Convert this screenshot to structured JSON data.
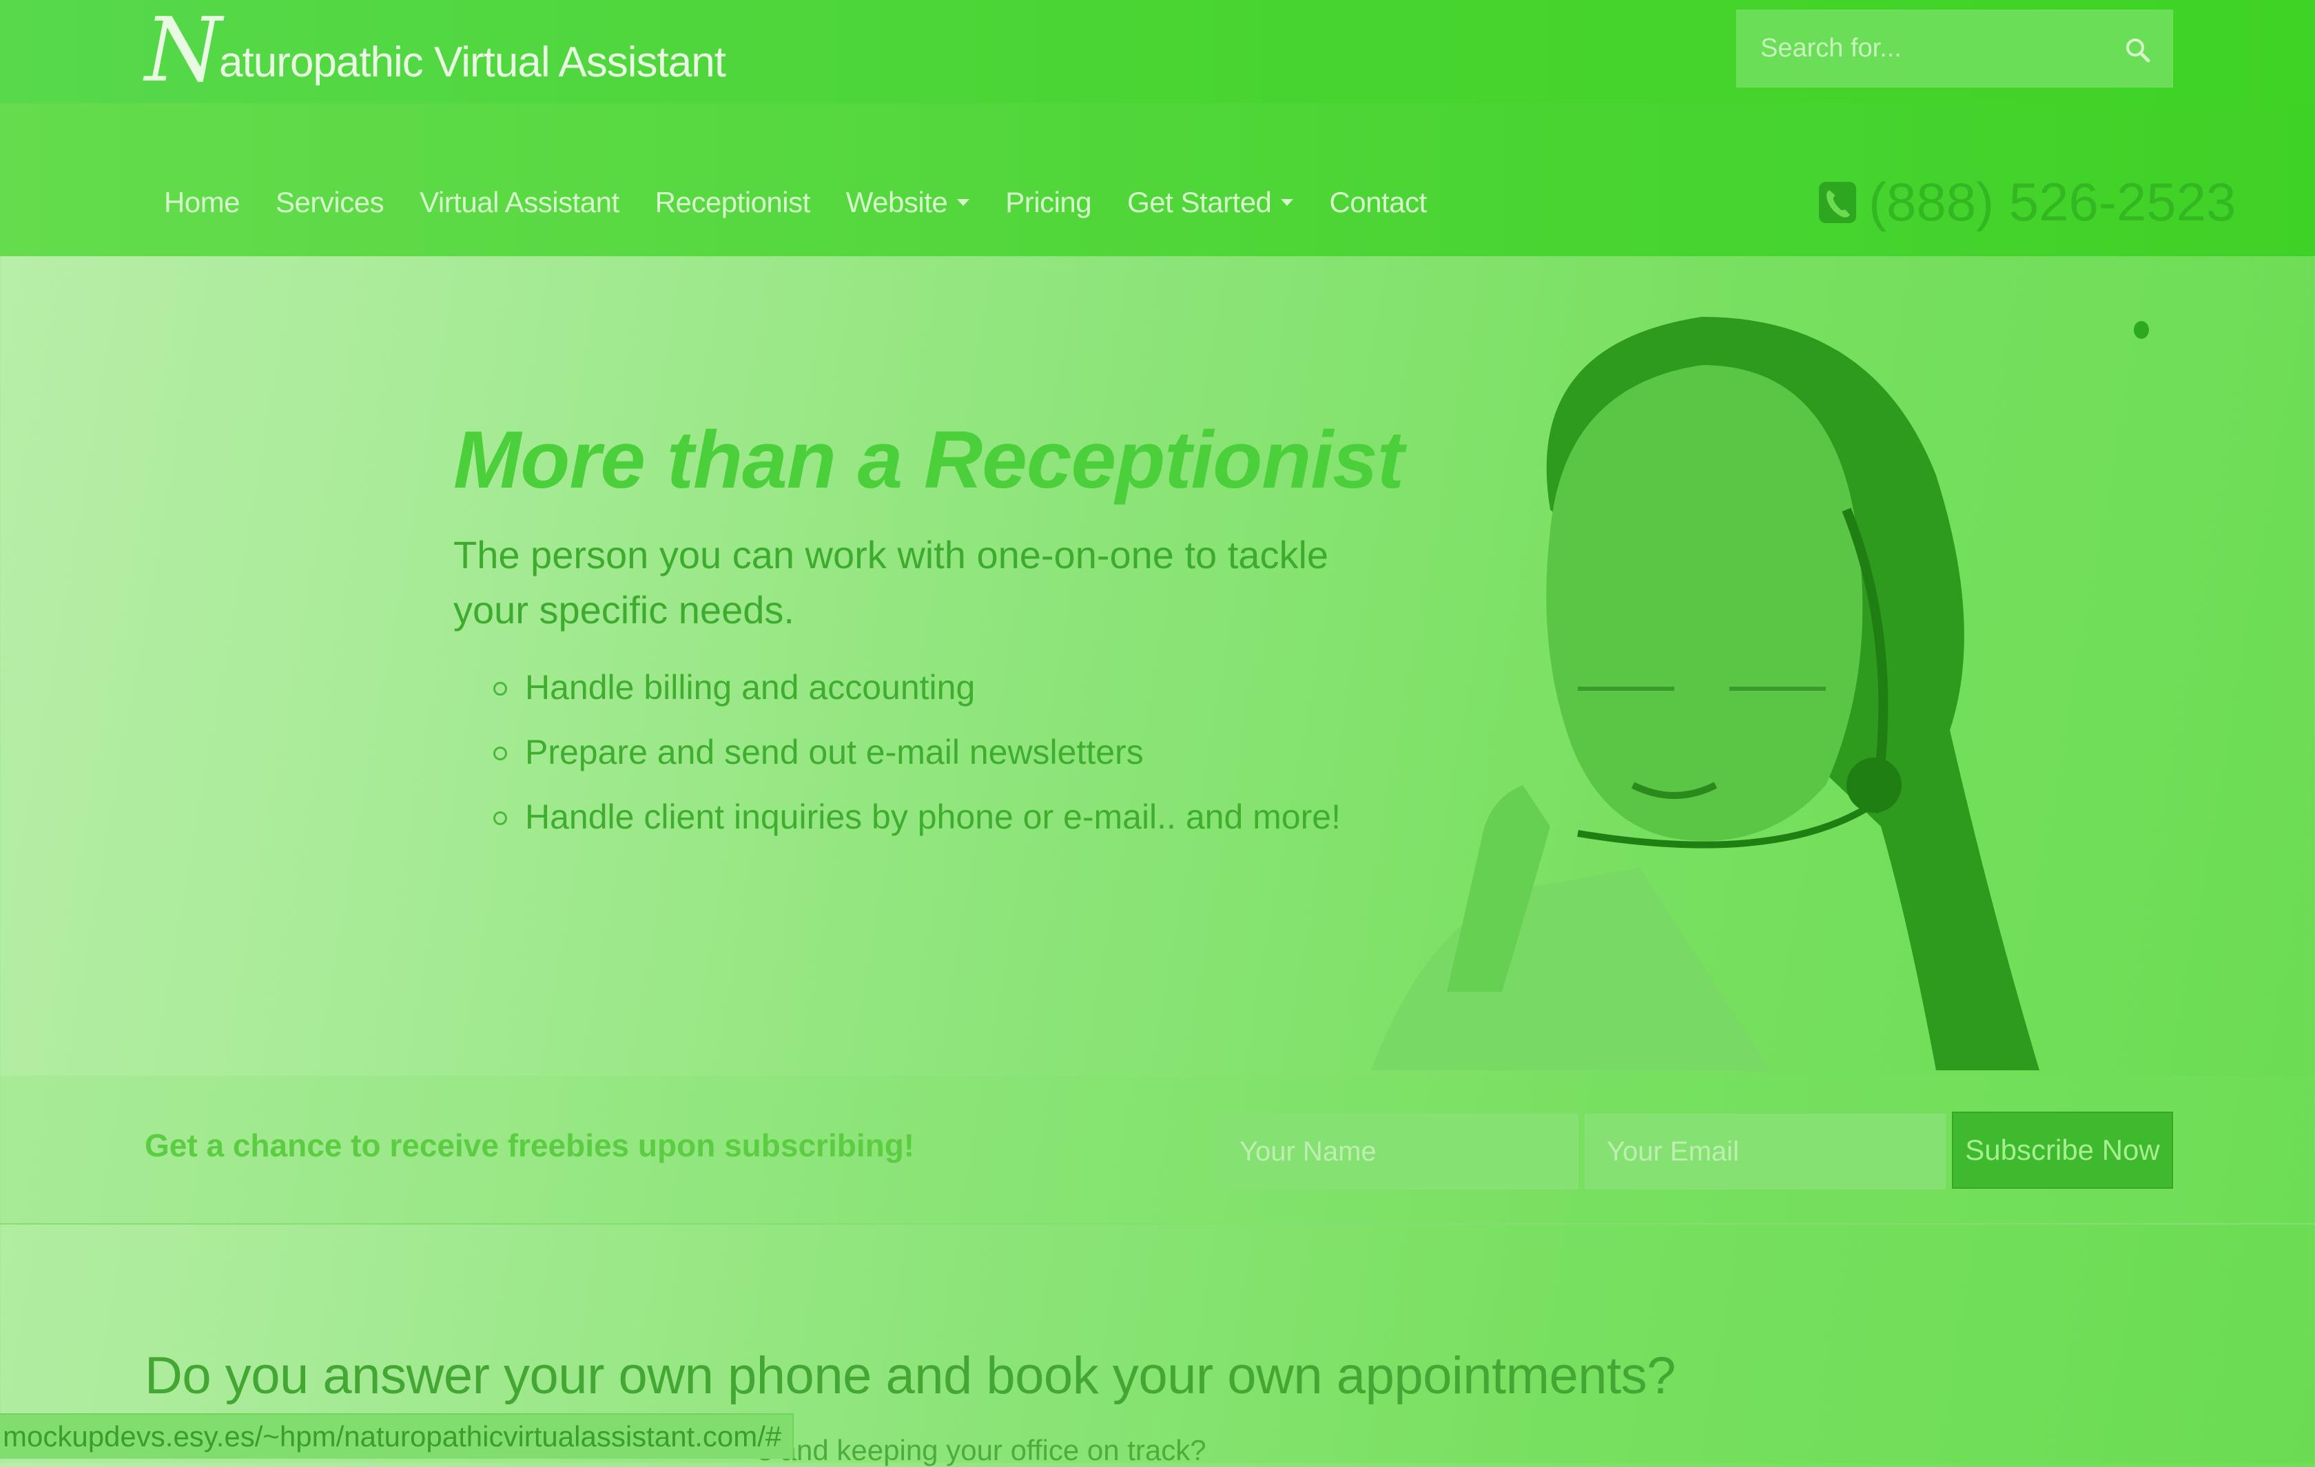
{
  "header": {
    "logo_initial": "N",
    "logo_text": "aturopathic Virtual Assistant",
    "search_placeholder": "Search for..."
  },
  "nav": {
    "items": [
      {
        "label": "Home"
      },
      {
        "label": "Services"
      },
      {
        "label": "Virtual Assistant"
      },
      {
        "label": "Receptionist"
      },
      {
        "label": "Website",
        "dropdown": true
      },
      {
        "label": "Pricing"
      },
      {
        "label": "Get Started",
        "dropdown": true
      },
      {
        "label": "Contact"
      }
    ],
    "phone": "(888) 526-2523"
  },
  "hero": {
    "title": "More than a Receptionist",
    "subtitle": "The person you can work with one-on-one to tackle your specific needs.",
    "bullets": [
      "Handle billing and accounting",
      "Prepare and send out e-mail newsletters",
      "Handle client inquiries by phone or e-mail.. and more!"
    ]
  },
  "subscribe": {
    "text": "Get a chance to receive freebies upon subscribing!",
    "name_placeholder": "Your Name",
    "email_placeholder": "Your Email",
    "button_label": "Subscribe Now"
  },
  "section": {
    "heading": "Do you answer your own phone and book your own appointments?",
    "partial_text": "s and keeping your office on track?"
  },
  "status_bar": {
    "url": "mockupdevs.esy.es/~hpm/naturopathicvirtualassistant.com/#"
  },
  "colors": {
    "overlay_green": "#3fd326",
    "button_green": "#3fb92d",
    "phone_green": "#33b822"
  },
  "icons": {
    "search": "search-icon",
    "phone": "phone-icon",
    "caret": "caret-down-icon"
  }
}
